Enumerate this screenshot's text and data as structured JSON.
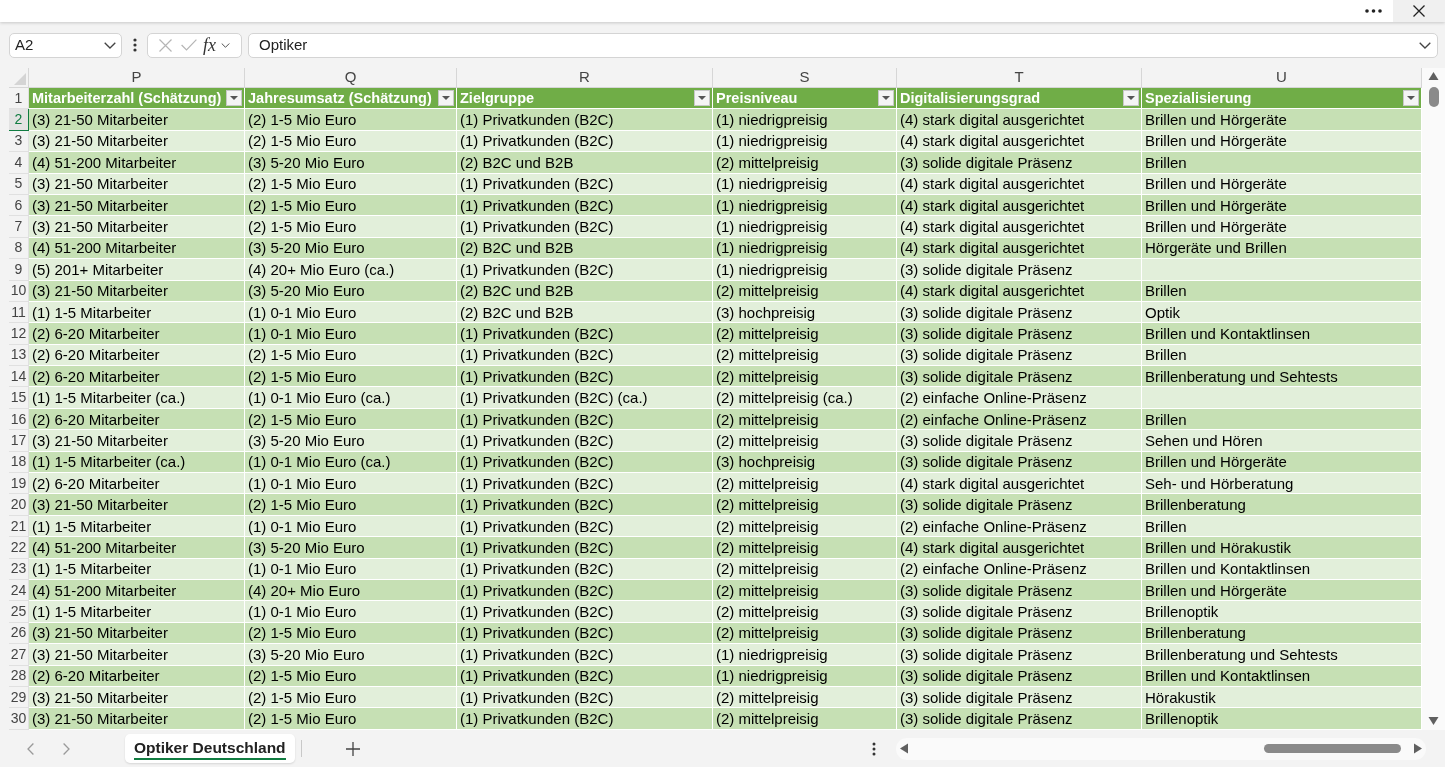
{
  "formula_bar": {
    "name_box": "A2",
    "function_button": "fx",
    "formula": "Optiker"
  },
  "table": {
    "header_row_number": "1",
    "columns": [
      {
        "letter": "P",
        "title": "Mitarbeiterzahl (Schätzung)"
      },
      {
        "letter": "Q",
        "title": "Jahresumsatz (Schätzung)"
      },
      {
        "letter": "R",
        "title": "Zielgruppe"
      },
      {
        "letter": "S",
        "title": "Preisniveau"
      },
      {
        "letter": "T",
        "title": "Digitalisierungsgrad"
      },
      {
        "letter": "U",
        "title": "Spezialisierung"
      }
    ],
    "rows": [
      {
        "number": "2",
        "selected": true,
        "cells": [
          "(3) 21-50 Mitarbeiter",
          "(2) 1-5 Mio Euro",
          "(1) Privatkunden (B2C)",
          "(1) niedrigpreisig",
          "(4) stark digital ausgerichtet",
          "Brillen und Hörgeräte"
        ]
      },
      {
        "number": "3",
        "selected": false,
        "cells": [
          "(3) 21-50 Mitarbeiter",
          "(2) 1-5 Mio Euro",
          "(1) Privatkunden (B2C)",
          "(1) niedrigpreisig",
          "(4) stark digital ausgerichtet",
          "Brillen und Hörgeräte"
        ]
      },
      {
        "number": "4",
        "selected": false,
        "cells": [
          "(4) 51-200 Mitarbeiter",
          "(3) 5-20 Mio Euro",
          "(2) B2C und B2B",
          "(2) mittelpreisig",
          "(3) solide digitale Präsenz",
          "Brillen"
        ]
      },
      {
        "number": "5",
        "selected": false,
        "cells": [
          "(3) 21-50 Mitarbeiter",
          "(2) 1-5 Mio Euro",
          "(1) Privatkunden (B2C)",
          "(1) niedrigpreisig",
          "(4) stark digital ausgerichtet",
          "Brillen und Hörgeräte"
        ]
      },
      {
        "number": "6",
        "selected": false,
        "cells": [
          "(3) 21-50 Mitarbeiter",
          "(2) 1-5 Mio Euro",
          "(1) Privatkunden (B2C)",
          "(1) niedrigpreisig",
          "(4) stark digital ausgerichtet",
          "Brillen und Hörgeräte"
        ]
      },
      {
        "number": "7",
        "selected": false,
        "cells": [
          "(3) 21-50 Mitarbeiter",
          "(2) 1-5 Mio Euro",
          "(1) Privatkunden (B2C)",
          "(1) niedrigpreisig",
          "(4) stark digital ausgerichtet",
          "Brillen und Hörgeräte"
        ]
      },
      {
        "number": "8",
        "selected": false,
        "cells": [
          "(4) 51-200 Mitarbeiter",
          "(3) 5-20 Mio Euro",
          "(2) B2C und B2B",
          "(1) niedrigpreisig",
          "(4) stark digital ausgerichtet",
          "Hörgeräte und Brillen"
        ]
      },
      {
        "number": "9",
        "selected": false,
        "cells": [
          "(5) 201+ Mitarbeiter",
          "(4) 20+ Mio Euro (ca.)",
          "(1) Privatkunden (B2C)",
          "(1) niedrigpreisig",
          "(3) solide digitale Präsenz"
        ]
      },
      {
        "number": "10",
        "selected": false,
        "cells": [
          "(3) 21-50 Mitarbeiter",
          "(3) 5-20 Mio Euro",
          "(2) B2C und B2B",
          "(2) mittelpreisig",
          "(4) stark digital ausgerichtet",
          "Brillen"
        ]
      },
      {
        "number": "11",
        "selected": false,
        "cells": [
          "(1) 1-5 Mitarbeiter",
          "(1) 0-1 Mio Euro",
          "(2) B2C und B2B",
          "(3) hochpreisig",
          "(3) solide digitale Präsenz",
          "Optik"
        ]
      },
      {
        "number": "12",
        "selected": false,
        "cells": [
          "(2) 6-20 Mitarbeiter",
          "(1) 0-1 Mio Euro",
          "(1) Privatkunden (B2C)",
          "(2) mittelpreisig",
          "(3) solide digitale Präsenz",
          "Brillen und Kontaktlinsen"
        ]
      },
      {
        "number": "13",
        "selected": false,
        "cells": [
          "(2) 6-20 Mitarbeiter",
          "(2) 1-5 Mio Euro",
          "(1) Privatkunden (B2C)",
          "(2) mittelpreisig",
          "(3) solide digitale Präsenz",
          "Brillen"
        ]
      },
      {
        "number": "14",
        "selected": false,
        "cells": [
          "(2) 6-20 Mitarbeiter",
          "(2) 1-5 Mio Euro",
          "(1) Privatkunden (B2C)",
          "(2) mittelpreisig",
          "(3) solide digitale Präsenz",
          "Brillenberatung und Sehtests"
        ]
      },
      {
        "number": "15",
        "selected": false,
        "cells": [
          "(1) 1-5 Mitarbeiter (ca.)",
          "(1) 0-1 Mio Euro (ca.)",
          "(1) Privatkunden (B2C) (ca.)",
          "(2) mittelpreisig (ca.)",
          "(2) einfache Online-Präsenz"
        ]
      },
      {
        "number": "16",
        "selected": false,
        "cells": [
          "(2) 6-20 Mitarbeiter",
          "(2) 1-5 Mio Euro",
          "(1) Privatkunden (B2C)",
          "(2) mittelpreisig",
          "(2) einfache Online-Präsenz",
          "Brillen"
        ]
      },
      {
        "number": "17",
        "selected": false,
        "cells": [
          "(3) 21-50 Mitarbeiter",
          "(3) 5-20 Mio Euro",
          "(1) Privatkunden (B2C)",
          "(2) mittelpreisig",
          "(3) solide digitale Präsenz",
          "Sehen und Hören"
        ]
      },
      {
        "number": "18",
        "selected": false,
        "cells": [
          "(1) 1-5 Mitarbeiter (ca.)",
          "(1) 0-1 Mio Euro (ca.)",
          "(1) Privatkunden (B2C)",
          "(3) hochpreisig",
          "(3) solide digitale Präsenz",
          "Brillen und Hörgeräte"
        ]
      },
      {
        "number": "19",
        "selected": false,
        "cells": [
          "(2) 6-20 Mitarbeiter",
          "(1) 0-1 Mio Euro",
          "(1) Privatkunden (B2C)",
          "(2) mittelpreisig",
          "(4) stark digital ausgerichtet",
          "Seh- und Hörberatung"
        ]
      },
      {
        "number": "20",
        "selected": false,
        "cells": [
          "(3) 21-50 Mitarbeiter",
          "(2) 1-5 Mio Euro",
          "(1) Privatkunden (B2C)",
          "(2) mittelpreisig",
          "(3) solide digitale Präsenz",
          "Brillenberatung"
        ]
      },
      {
        "number": "21",
        "selected": false,
        "cells": [
          "(1) 1-5 Mitarbeiter",
          "(1) 0-1 Mio Euro",
          "(1) Privatkunden (B2C)",
          "(2) mittelpreisig",
          "(2) einfache Online-Präsenz",
          "Brillen"
        ]
      },
      {
        "number": "22",
        "selected": false,
        "cells": [
          "(4) 51-200 Mitarbeiter",
          "(3) 5-20 Mio Euro",
          "(1) Privatkunden (B2C)",
          "(2) mittelpreisig",
          "(4) stark digital ausgerichtet",
          "Brillen und Hörakustik"
        ]
      },
      {
        "number": "23",
        "selected": false,
        "cells": [
          "(1) 1-5 Mitarbeiter",
          "(1) 0-1 Mio Euro",
          "(1) Privatkunden (B2C)",
          "(2) mittelpreisig",
          "(2) einfache Online-Präsenz",
          "Brillen und Kontaktlinsen"
        ]
      },
      {
        "number": "24",
        "selected": false,
        "cells": [
          "(4) 51-200 Mitarbeiter",
          "(4) 20+ Mio Euro",
          "(1) Privatkunden (B2C)",
          "(2) mittelpreisig",
          "(3) solide digitale Präsenz",
          "Brillen und Hörgeräte"
        ]
      },
      {
        "number": "25",
        "selected": false,
        "cells": [
          "(1) 1-5 Mitarbeiter",
          "(1) 0-1 Mio Euro",
          "(1) Privatkunden (B2C)",
          "(2) mittelpreisig",
          "(3) solide digitale Präsenz",
          "Brillenoptik"
        ]
      },
      {
        "number": "26",
        "selected": false,
        "cells": [
          "(3) 21-50 Mitarbeiter",
          "(2) 1-5 Mio Euro",
          "(1) Privatkunden (B2C)",
          "(2) mittelpreisig",
          "(3) solide digitale Präsenz",
          "Brillenberatung"
        ]
      },
      {
        "number": "27",
        "selected": false,
        "cells": [
          "(3) 21-50 Mitarbeiter",
          "(3) 5-20 Mio Euro",
          "(1) Privatkunden (B2C)",
          "(1) niedrigpreisig",
          "(3) solide digitale Präsenz",
          "Brillenberatung und Sehtests"
        ]
      },
      {
        "number": "28",
        "selected": false,
        "cells": [
          "(2) 6-20 Mitarbeiter",
          "(2) 1-5 Mio Euro",
          "(1) Privatkunden (B2C)",
          "(1) niedrigpreisig",
          "(3) solide digitale Präsenz",
          "Brillen und Kontaktlinsen"
        ]
      },
      {
        "number": "29",
        "selected": false,
        "cells": [
          "(3) 21-50 Mitarbeiter",
          "(2) 1-5 Mio Euro",
          "(1) Privatkunden (B2C)",
          "(2) mittelpreisig",
          "(3) solide digitale Präsenz",
          "Hörakustik"
        ]
      },
      {
        "number": "30",
        "selected": false,
        "cells": [
          "(3) 21-50 Mitarbeiter",
          "(2) 1-5 Mio Euro",
          "(1) Privatkunden (B2C)",
          "(2) mittelpreisig",
          "(3) solide digitale Präsenz",
          "Brillenoptik"
        ]
      }
    ]
  },
  "sheet_tabs": [
    {
      "label": "Optiker Deutschland",
      "selected": true
    }
  ]
}
